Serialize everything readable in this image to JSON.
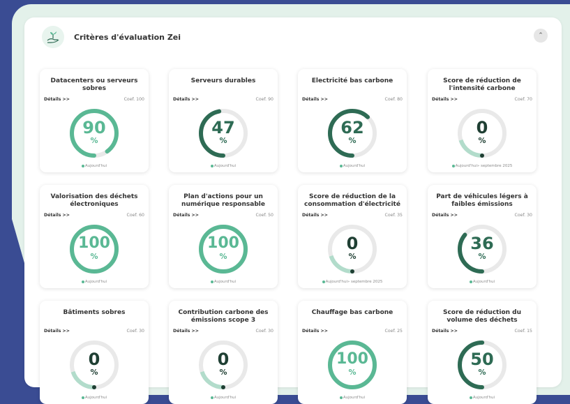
{
  "panel": {
    "title": "Critères d'évaluation Zei",
    "collapse_icon": "chevron-up-icon"
  },
  "colors": {
    "light": "#5ab894",
    "dark": "#2e6b54",
    "pale": "#b2dccb",
    "track": "#e9e9e9",
    "text_light": "#5ab894",
    "text_dark": "#2e6b54"
  },
  "cards": [
    {
      "title": "Datacenters ou serveurs sobres",
      "details": "Détails >>",
      "coef": "Coef. 100",
      "value": "90",
      "percent": 90,
      "unit": "%",
      "date": "Aujourd'hui"
    },
    {
      "title": "Serveurs durables",
      "details": "Détails >>",
      "coef": "Coef. 90",
      "value": "47",
      "percent": 47,
      "unit": "%",
      "date": "Aujourd'hui"
    },
    {
      "title": "Electricité bas carbone",
      "details": "Détails >>",
      "coef": "Coef. 80",
      "value": "62",
      "percent": 62,
      "unit": "%",
      "date": "Aujourd'hui"
    },
    {
      "title": "Score de réduction de l'intensité carbone",
      "details": "Détails >>",
      "coef": "Coef. 70",
      "value": "0",
      "percent": 0,
      "unit": "%",
      "date": "Aujourd'hui» septembre 2025"
    },
    {
      "title": "Valorisation des déchets électroniques",
      "details": "Détails >>",
      "coef": "Coef. 60",
      "value": "100",
      "percent": 100,
      "unit": "%",
      "date": "Aujourd'hui"
    },
    {
      "title": "Plan d'actions pour un numérique responsable",
      "details": "Détails >>",
      "coef": "Coef. 50",
      "value": "100",
      "percent": 100,
      "unit": "%",
      "date": "Aujourd'hui"
    },
    {
      "title": "Score de réduction de la consommation d'électricité",
      "details": "Détails >>",
      "coef": "Coef. 35",
      "value": "0",
      "percent": 0,
      "unit": "%",
      "date": "Aujourd'hui» septembre 2025"
    },
    {
      "title": "Part de véhicules légers à faibles émissions",
      "details": "Détails >>",
      "coef": "Coef. 30",
      "value": "36",
      "percent": 36,
      "unit": "%",
      "date": "Aujourd'hui"
    },
    {
      "title": "Bâtiments sobres",
      "details": "Détails >>",
      "coef": "Coef. 30",
      "value": "0",
      "percent": 0,
      "unit": "%",
      "date": "Aujourd'hui"
    },
    {
      "title": "Contribution carbone des émissions scope 3",
      "details": "Détails >>",
      "coef": "Coef. 30",
      "value": "0",
      "percent": 0,
      "unit": "%",
      "date": "Aujourd'hui"
    },
    {
      "title": "Chauffage bas carbone",
      "details": "Détails >>",
      "coef": "Coef. 25",
      "value": "100",
      "percent": 100,
      "unit": "%",
      "date": "Aujourd'hui"
    },
    {
      "title": "Score de réduction du volume des déchets",
      "details": "Détails >>",
      "coef": "Coef. 15",
      "value": "50",
      "percent": 50,
      "unit": "%",
      "date": "Aujourd'hui"
    }
  ]
}
